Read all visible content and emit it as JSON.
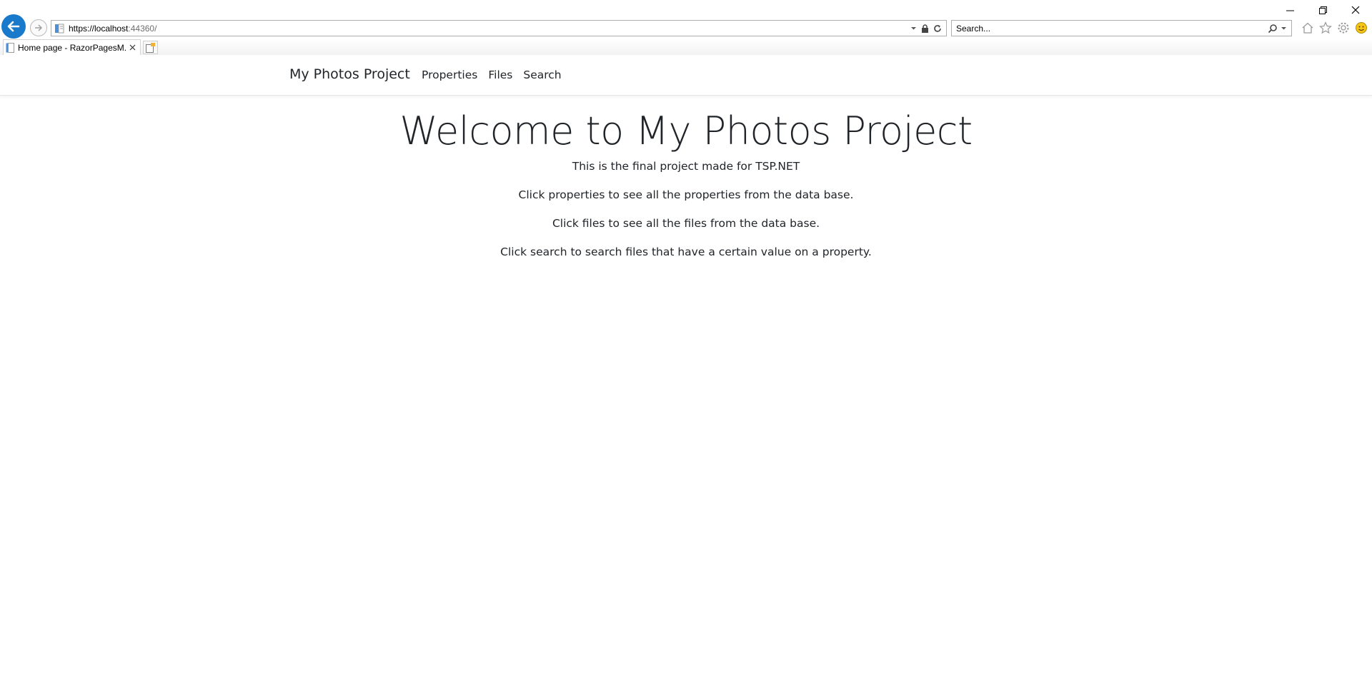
{
  "browser": {
    "address": {
      "host": "https://localhost",
      "rest": ":44360/"
    },
    "search_placeholder": "Search...",
    "tab": {
      "title": "Home page - RazorPagesM..."
    }
  },
  "site": {
    "brand": "My Photos Project",
    "nav": [
      {
        "label": "Properties"
      },
      {
        "label": "Files"
      },
      {
        "label": "Search"
      }
    ]
  },
  "main": {
    "title": "Welcome to My Photos Project",
    "paragraphs": [
      "This is the final project made for TSP.NET",
      "Click properties to see all the properties from the data base.",
      "Click files to see all the files from the data base.",
      "Click search to search files that have a certain value on a property."
    ]
  },
  "colors": {
    "back_button": "#1979ca",
    "text": "#212529"
  }
}
